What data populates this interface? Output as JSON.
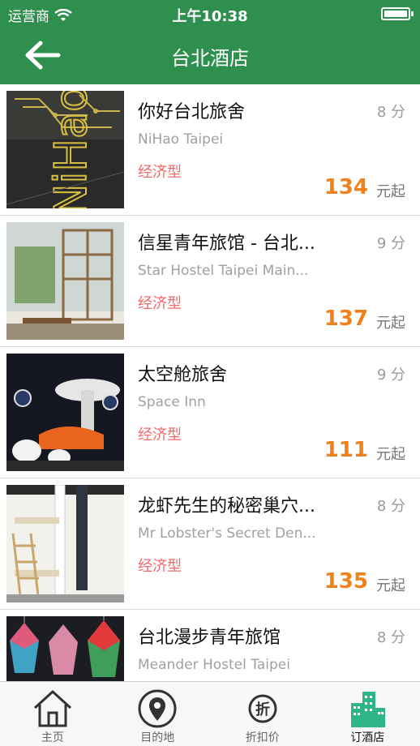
{
  "status_bar": {
    "carrier": "运营商",
    "time": "上午10:38"
  },
  "header": {
    "title": "台北酒店"
  },
  "colors": {
    "header": "#2f8f4f",
    "price": "#f0821e",
    "type": "#f06a6a",
    "active_tab": "#2fb58a"
  },
  "hotels": [
    {
      "name": "你好台北旅舍",
      "english": "NiHao Taipei",
      "type": "经济型",
      "distance": "8 分",
      "price": "134",
      "unit": "元起"
    },
    {
      "name": "信星青年旅馆 - 台北...",
      "english": "Star Hostel Taipei Main...",
      "type": "经济型",
      "distance": "9 分",
      "price": "137",
      "unit": "元起"
    },
    {
      "name": "太空舱旅舍",
      "english": "Space Inn",
      "type": "经济型",
      "distance": "9 分",
      "price": "111",
      "unit": "元起"
    },
    {
      "name": "龙虾先生的秘密巢穴...",
      "english": "Mr Lobster's Secret Den...",
      "type": "经济型",
      "distance": "8 分",
      "price": "135",
      "unit": "元起"
    },
    {
      "name": "台北漫步青年旅馆",
      "english": "Meander Hostel Taipei",
      "type": "",
      "distance": "8 分",
      "price": "",
      "unit": ""
    }
  ],
  "tabs": [
    {
      "label": "主页",
      "icon": "home-icon"
    },
    {
      "label": "目的地",
      "icon": "location-pin-icon"
    },
    {
      "label": "折扣价",
      "icon": "discount-icon"
    },
    {
      "label": "订酒店",
      "icon": "hotel-buildings-icon",
      "active": true
    }
  ]
}
